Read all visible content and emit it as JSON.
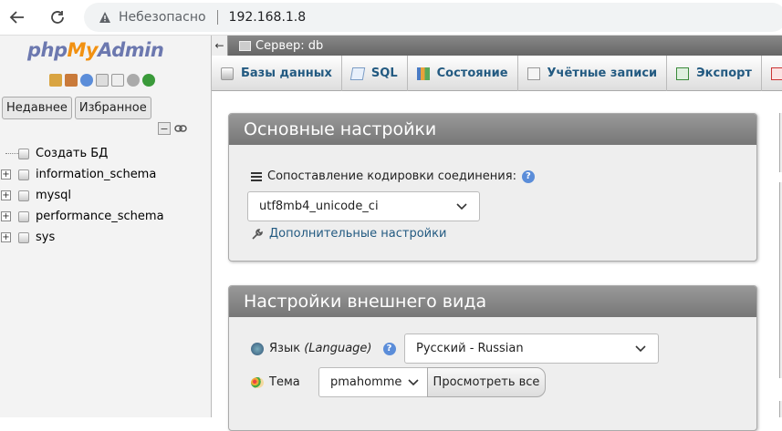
{
  "browser": {
    "security_label": "Небезопасно",
    "url": "192.168.1.8"
  },
  "sidebar": {
    "logo": {
      "php": "php",
      "my": "My",
      "admin": "Admin"
    },
    "tabs": [
      "Недавнее",
      "Избранное"
    ],
    "tree": [
      {
        "label": "Создать БД",
        "expandable": false
      },
      {
        "label": "information_schema",
        "expandable": true
      },
      {
        "label": "mysql",
        "expandable": true
      },
      {
        "label": "performance_schema",
        "expandable": true
      },
      {
        "label": "sys",
        "expandable": true
      }
    ]
  },
  "header": {
    "server": "Сервер: db",
    "collapse_symbol": "←"
  },
  "menu": [
    {
      "label": "Базы данных",
      "icon": "database-icon"
    },
    {
      "label": "SQL",
      "icon": "sql-icon"
    },
    {
      "label": "Состояние",
      "icon": "status-chart-icon"
    },
    {
      "label": "Учётные записи",
      "icon": "user-accounts-icon"
    },
    {
      "label": "Экспорт",
      "icon": "export-icon"
    }
  ],
  "general_settings": {
    "title": "Основные настройки",
    "collation_label": "Сопоставление кодировки соединения:",
    "collation_value": "utf8mb4_unicode_ci",
    "more_settings_link": "Дополнительные настройки"
  },
  "appearance_settings": {
    "title": "Настройки внешнего вида",
    "language_label_prefix": "Язык ",
    "language_label_italic": "(Language)",
    "language_value": "Русский - Russian",
    "theme_label": "Тема",
    "theme_value": "pmahomme",
    "view_all_button": "Просмотреть все"
  },
  "colors": {
    "link": "#235a81",
    "logo_blue": "#6c78af",
    "logo_orange": "#f29111",
    "panel_header": "#888888"
  }
}
